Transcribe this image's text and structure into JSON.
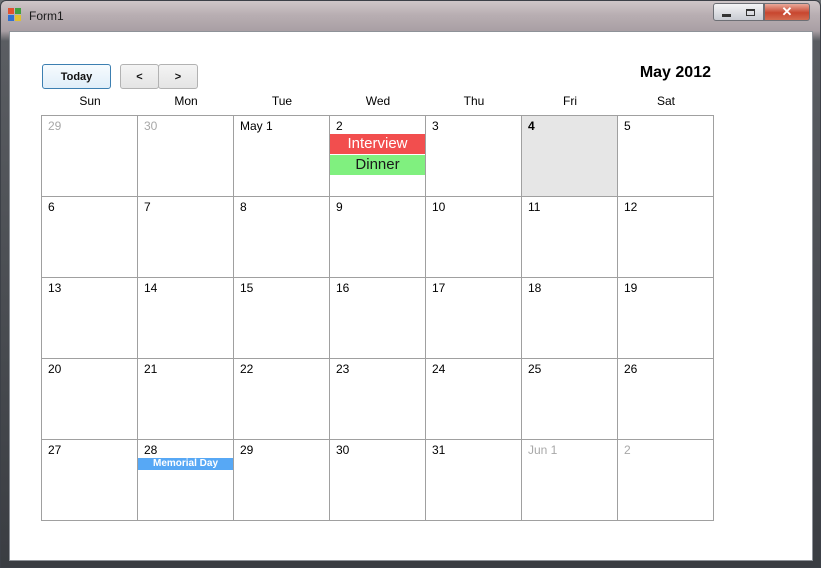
{
  "window": {
    "title": "Form1",
    "close_glyph": "✕"
  },
  "toolbar": {
    "today_label": "Today",
    "prev_label": "<",
    "next_label": ">"
  },
  "calendar": {
    "month_title": "May 2012",
    "weekdays": [
      "Sun",
      "Mon",
      "Tue",
      "Wed",
      "Thu",
      "Fri",
      "Sat"
    ],
    "weeks": [
      [
        {
          "label": "29",
          "other": true
        },
        {
          "label": "30",
          "other": true
        },
        {
          "label": "May 1"
        },
        {
          "label": "2",
          "events": [
            {
              "title": "Interview",
              "color": "#f24e4e",
              "text_color": "#ffffff",
              "size": "big"
            },
            {
              "title": "Dinner",
              "color": "#80f07f",
              "text_color": "#1a1a1a",
              "size": "big"
            }
          ]
        },
        {
          "label": "3"
        },
        {
          "label": "4",
          "today": true
        },
        {
          "label": "5"
        }
      ],
      [
        {
          "label": "6"
        },
        {
          "label": "7"
        },
        {
          "label": "8"
        },
        {
          "label": "9"
        },
        {
          "label": "10"
        },
        {
          "label": "11"
        },
        {
          "label": "12"
        }
      ],
      [
        {
          "label": "13"
        },
        {
          "label": "14"
        },
        {
          "label": "15"
        },
        {
          "label": "16"
        },
        {
          "label": "17"
        },
        {
          "label": "18"
        },
        {
          "label": "19"
        }
      ],
      [
        {
          "label": "20"
        },
        {
          "label": "21"
        },
        {
          "label": "22"
        },
        {
          "label": "23"
        },
        {
          "label": "24"
        },
        {
          "label": "25"
        },
        {
          "label": "26"
        }
      ],
      [
        {
          "label": "27"
        },
        {
          "label": "28",
          "events": [
            {
              "title": "Memorial Day",
              "color": "#57a8f5",
              "text_color": "#ffffff",
              "size": "small"
            }
          ]
        },
        {
          "label": "29"
        },
        {
          "label": "30"
        },
        {
          "label": "31"
        },
        {
          "label": "Jun 1",
          "other": true
        },
        {
          "label": "2",
          "other": true
        }
      ]
    ]
  },
  "colors": {
    "today_cell": "#e6e6e6",
    "grid_line": "#a0a0a0",
    "other_month_text": "#a8a8a8"
  },
  "icons": {
    "app_icon": "windows-form-icon",
    "minimize": "minimize-icon",
    "maximize": "maximize-icon",
    "close": "close-icon"
  }
}
